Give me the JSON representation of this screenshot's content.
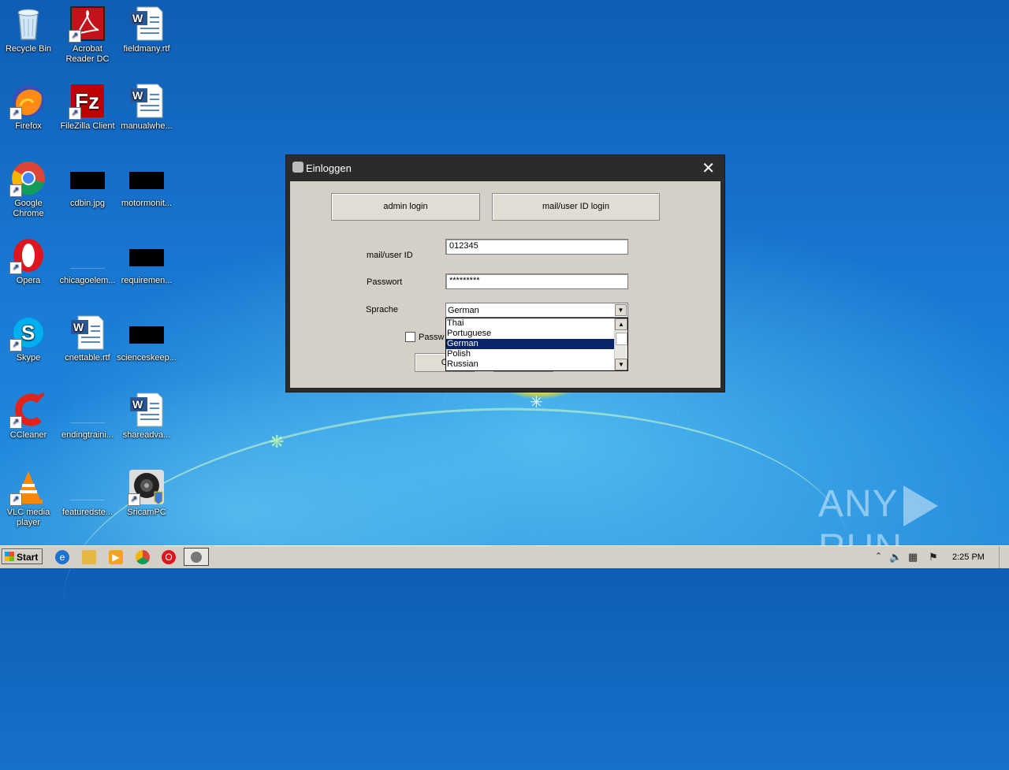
{
  "desktop": {
    "icons": [
      {
        "label": "Recycle Bin",
        "icon": "recycle-bin-icon"
      },
      {
        "label": "Acrobat Reader DC",
        "icon": "acrobat-icon"
      },
      {
        "label": "fieldmany.rtf",
        "icon": "word-document-icon"
      },
      {
        "label": "Firefox",
        "icon": "firefox-icon"
      },
      {
        "label": "FileZilla Client",
        "icon": "filezilla-icon"
      },
      {
        "label": "manualwhe...",
        "icon": "word-document-icon"
      },
      {
        "label": "Google Chrome",
        "icon": "chrome-icon"
      },
      {
        "label": "cdbin.jpg",
        "icon": "image-file-icon"
      },
      {
        "label": "motormonit...",
        "icon": "file-icon"
      },
      {
        "label": "Opera",
        "icon": "opera-icon"
      },
      {
        "label": "chicagoelem...",
        "icon": "file-icon"
      },
      {
        "label": "requiremen...",
        "icon": "file-icon"
      },
      {
        "label": "Skype",
        "icon": "skype-icon"
      },
      {
        "label": "cnettable.rtf",
        "icon": "word-document-icon"
      },
      {
        "label": "scienceskeep...",
        "icon": "file-icon"
      },
      {
        "label": "CCleaner",
        "icon": "ccleaner-icon"
      },
      {
        "label": "endingtraini...",
        "icon": "file-icon"
      },
      {
        "label": "shareadva...",
        "icon": "word-document-icon"
      },
      {
        "label": "VLC media player",
        "icon": "vlc-icon"
      },
      {
        "label": "featuredste...",
        "icon": "file-icon"
      },
      {
        "label": "SricamPC",
        "icon": "sricam-icon"
      }
    ]
  },
  "dialog": {
    "title": "Einloggen",
    "close_glyph": "✕",
    "admin_login_label": "admin login",
    "mail_login_label": "mail/user ID login",
    "mail_label": "mail/user ID",
    "mail_value": "012345",
    "password_label": "Passwort",
    "password_value": "*********",
    "language_label": "Sprache",
    "language_selected": "German",
    "language_options": [
      "Thai",
      "Portuguese",
      "German",
      "Polish",
      "Russian"
    ],
    "remember_label": "Passw",
    "ok_label": "O"
  },
  "taskbar": {
    "start_label": "Start",
    "clock": "2:25 PM"
  },
  "watermark": {
    "left": "ANY",
    "right": "RUN"
  }
}
